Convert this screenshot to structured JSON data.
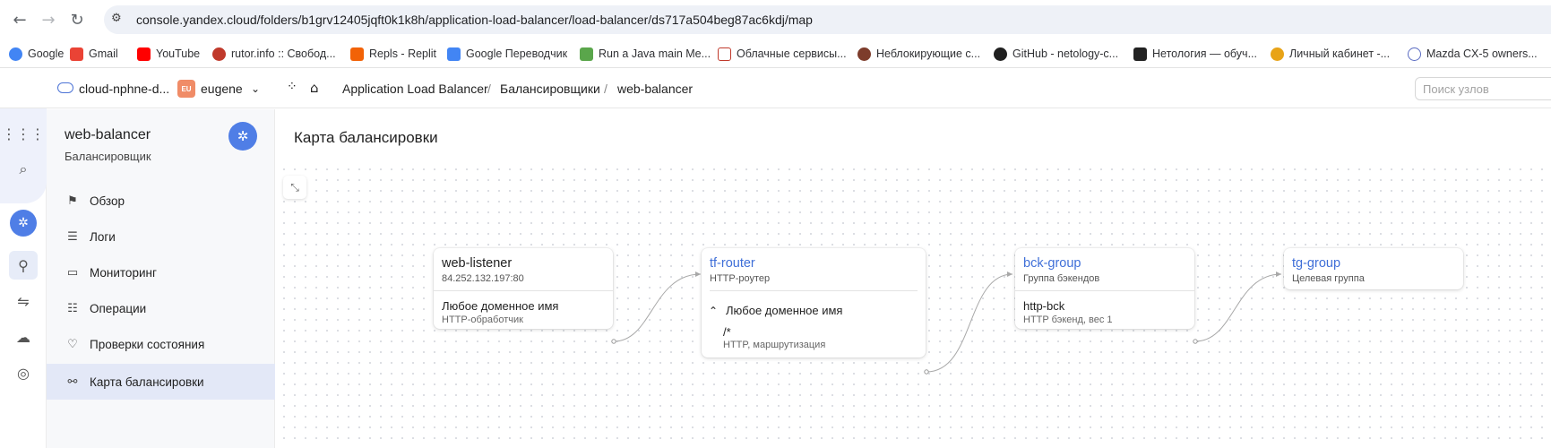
{
  "browser": {
    "url": "console.yandex.cloud/folders/b1grv12405jqft0k1k8h/application-load-balancer/load-balancer/ds717a504beg87ac6kdj/map",
    "bookmarks": [
      {
        "label": "Google",
        "color": "#4285f4"
      },
      {
        "label": "Gmail",
        "color": "#ea4335"
      },
      {
        "label": "YouTube",
        "color": "#ff0000"
      },
      {
        "label": "rutor.info :: Свобод...",
        "color": "#c0392b"
      },
      {
        "label": "Repls - Replit",
        "color": "#f26207"
      },
      {
        "label": "Google Переводчик",
        "color": "#4285f4"
      },
      {
        "label": "Run a Java main Me...",
        "color": "#5aa64b"
      },
      {
        "label": "Облачные сервисы...",
        "color": "#c0392b"
      },
      {
        "label": "Неблокирующие с...",
        "color": "#7d3c2b"
      },
      {
        "label": "GitHub - netology-c...",
        "color": "#1f1f1f"
      },
      {
        "label": "Нетология — обуч...",
        "color": "#222222"
      },
      {
        "label": "Личный кабинет -...",
        "color": "#e8a317"
      },
      {
        "label": "Mazda CX-5 owners...",
        "color": "#5b6cc2"
      }
    ]
  },
  "header": {
    "cloud": "cloud-nphne-d...",
    "badge": "EU",
    "user": "eugene",
    "breadcrumb": [
      "Application Load Balancer",
      "Балансировщики",
      "web-balancer"
    ],
    "search_placeholder": "Поиск узлов"
  },
  "sidebar": {
    "title": "web-balancer",
    "subtitle": "Балансировщик",
    "items": [
      {
        "label": "Обзор",
        "icon": "flag-icon"
      },
      {
        "label": "Логи",
        "icon": "logs-icon"
      },
      {
        "label": "Мониторинг",
        "icon": "monitoring-icon"
      },
      {
        "label": "Операции",
        "icon": "operations-icon"
      },
      {
        "label": "Проверки состояния",
        "icon": "heartbeat-icon"
      },
      {
        "label": "Карта балансировки",
        "icon": "map-icon",
        "active": true
      }
    ]
  },
  "main": {
    "title": "Карта балансировки",
    "nodes": {
      "listener": {
        "title": "web-listener",
        "subtitle": "84.252.132.197:80",
        "item_title": "Любое доменное имя",
        "item_sub": "HTTP-обработчик"
      },
      "router": {
        "title": "tf-router",
        "subtitle": "HTTP-роутер",
        "section": "Любое доменное имя",
        "route": "/*",
        "route_sub": "HTTP, маршрутизация"
      },
      "backend": {
        "title": "bck-group",
        "subtitle": "Группа бэкендов",
        "item_title": "http-bck",
        "item_sub": "HTTP бэкенд, вес 1"
      },
      "target": {
        "title": "tg-group",
        "subtitle": "Целевая группа"
      }
    }
  },
  "colors": {
    "accent": "#4f7ee6",
    "link": "#3f6fd8"
  }
}
